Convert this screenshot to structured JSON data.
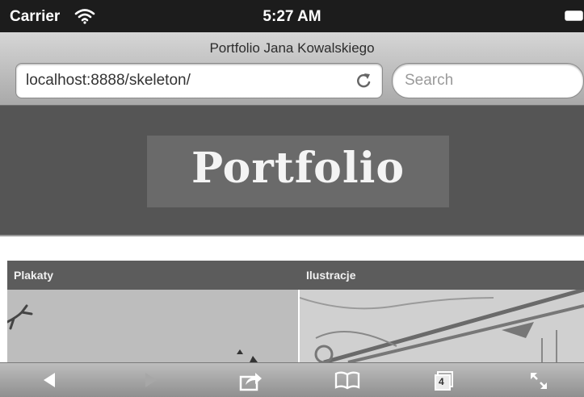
{
  "status_bar": {
    "carrier": "Carrier",
    "time": "5:27 AM",
    "icons": [
      "wifi-icon",
      "battery-icon"
    ]
  },
  "browser": {
    "page_title": "Portfolio Jana Kowalskiego",
    "url": "localhost:8888/skeleton/",
    "search_placeholder": "Search",
    "icons": [
      "reload-icon"
    ]
  },
  "page": {
    "logo_text": "Portfolio",
    "categories": [
      "Plakaty",
      "Ilustracje"
    ]
  },
  "toolbar": {
    "tabs_count": "4",
    "icons": [
      "back-arrow-icon",
      "forward-arrow-icon",
      "share-icon",
      "bookmarks-icon",
      "tabs-icon",
      "fullscreen-icon"
    ]
  },
  "colors": {
    "header_bg": "#555555",
    "category_bar": "#5c5c5c",
    "status_bar": "#1c1c1c"
  }
}
